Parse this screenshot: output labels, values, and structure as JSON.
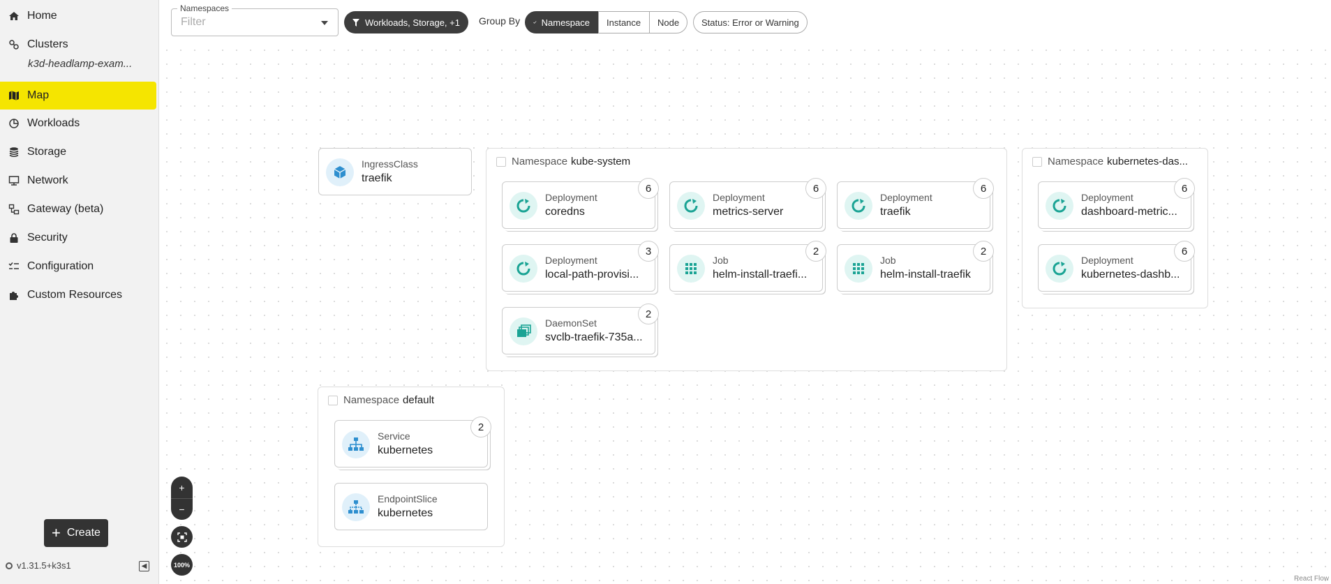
{
  "sidebar": {
    "items": [
      {
        "label": "Home",
        "icon": "home-icon"
      },
      {
        "label": "Clusters",
        "icon": "clusters-icon",
        "sub": "k3d-headlamp-exam..."
      },
      {
        "label": "Map",
        "icon": "map-icon",
        "active": true
      },
      {
        "label": "Workloads",
        "icon": "workloads-icon"
      },
      {
        "label": "Storage",
        "icon": "storage-icon"
      },
      {
        "label": "Network",
        "icon": "network-icon"
      },
      {
        "label": "Gateway (beta)",
        "icon": "gateway-icon"
      },
      {
        "label": "Security",
        "icon": "lock-icon"
      },
      {
        "label": "Configuration",
        "icon": "configuration-icon"
      },
      {
        "label": "Custom Resources",
        "icon": "puzzle-icon"
      }
    ],
    "create_label": "Create",
    "version": "v1.31.5+k3s1",
    "active_color": "#f5e500"
  },
  "toolbar": {
    "namespaces_label": "Namespaces",
    "namespaces_placeholder": "Filter",
    "filter_chip": "Workloads, Storage, +1",
    "group_by_label": "Group By",
    "group_by_options": [
      "Namespace",
      "Instance",
      "Node"
    ],
    "status_chip": "Status: Error or Warning"
  },
  "map": {
    "ingress": {
      "kind": "IngressClass",
      "name": "traefik"
    },
    "kube_system": {
      "title_prefix": "Namespace",
      "title_name": "kube-system",
      "nodes": [
        {
          "kind": "Deployment",
          "name": "coredns",
          "count": "6"
        },
        {
          "kind": "Deployment",
          "name": "metrics-server",
          "count": "6"
        },
        {
          "kind": "Deployment",
          "name": "traefik",
          "count": "6"
        },
        {
          "kind": "Deployment",
          "name": "local-path-provisi...",
          "count": "3"
        },
        {
          "kind": "Job",
          "name": "helm-install-traefi...",
          "count": "2"
        },
        {
          "kind": "Job",
          "name": "helm-install-traefik",
          "count": "2"
        },
        {
          "kind": "DaemonSet",
          "name": "svclb-traefik-735a...",
          "count": "2"
        }
      ]
    },
    "kubernetes_dashboard": {
      "title_prefix": "Namespace",
      "title_name": "kubernetes-das...",
      "nodes": [
        {
          "kind": "Deployment",
          "name": "dashboard-metric...",
          "count": "6"
        },
        {
          "kind": "Deployment",
          "name": "kubernetes-dashb...",
          "count": "6"
        }
      ]
    },
    "default": {
      "title_prefix": "Namespace",
      "title_name": "default",
      "nodes": [
        {
          "kind": "Service",
          "name": "kubernetes",
          "count": "2"
        },
        {
          "kind": "EndpointSlice",
          "name": "kubernetes"
        }
      ]
    }
  },
  "zoom": {
    "plus": "+",
    "minus": "−",
    "level": "100%"
  },
  "attribution": "React Flow",
  "colors": {
    "teal": "#1aa394",
    "blue": "#2e8fcf",
    "dark": "#3d3d3d"
  }
}
